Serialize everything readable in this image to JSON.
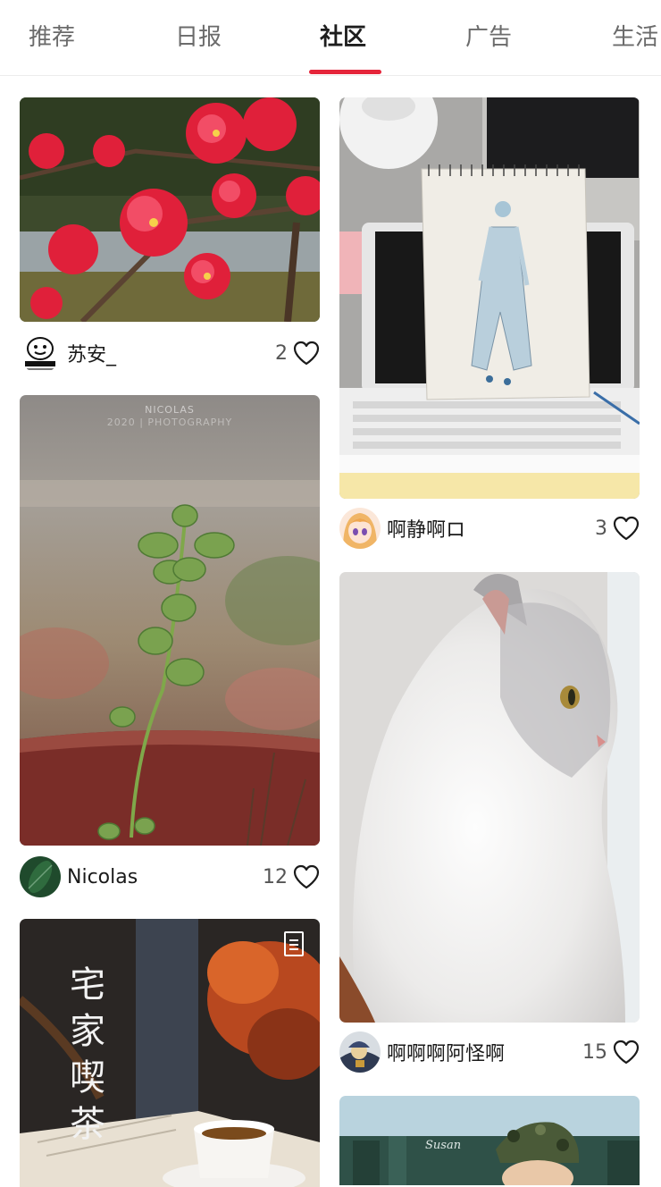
{
  "tabs": [
    {
      "label": "推荐"
    },
    {
      "label": "日报"
    },
    {
      "label": "社区",
      "active": true
    },
    {
      "label": "广告"
    },
    {
      "label": "生活"
    }
  ],
  "accent_color": "#e5253a",
  "feed": {
    "left": [
      {
        "author": "苏安_",
        "likes": "2",
        "image": "red-flowering-branch-photo",
        "avatar": "cartoon-meme-avatar"
      },
      {
        "author": "Nicolas",
        "likes": "12",
        "image": "mint-sprout-in-pot-photo",
        "image_text": "NICOLAS",
        "image_subtext": "2020 | PHOTOGRAPHY",
        "avatar": "green-leaf-avatar"
      },
      {
        "image": "home-tea-photo",
        "image_text": "宅家喫茶",
        "badge_icon": "article-icon"
      }
    ],
    "right": [
      {
        "author": "啊静啊ロ",
        "likes": "3",
        "image": "fashion-sketch-photo",
        "avatar": "anime-girl-avatar"
      },
      {
        "author": "啊啊啊阿怪啊",
        "likes": "15",
        "image": "white-cat-profile-photo",
        "avatar": "cartoon-character-avatar"
      },
      {
        "image": "soldier-illustration",
        "image_text": "Susan"
      }
    ]
  }
}
